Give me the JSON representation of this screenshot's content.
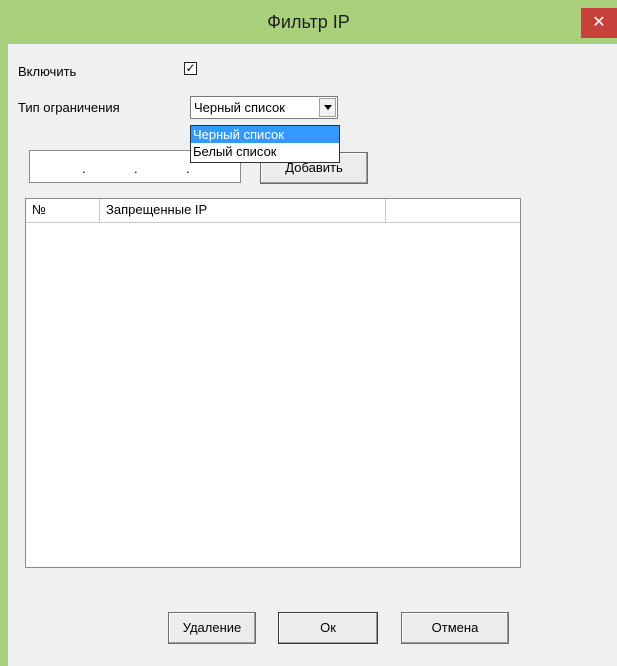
{
  "window": {
    "title": "Фильтр IP",
    "close_label": "✕",
    "accent_color": "#a9d17c",
    "close_color": "#c7403a"
  },
  "form": {
    "enable_label": "Включить",
    "enable_checked": true,
    "enable_mark": "✓",
    "restriction_label": "Тип ограничения",
    "restriction_value": "Черный список",
    "restriction_options": [
      "Черный список",
      "Белый список"
    ],
    "ip_dots": [
      ".",
      ".",
      "."
    ],
    "add_label": "Добавить"
  },
  "table": {
    "columns": [
      "№",
      "Запрещенные IP",
      ""
    ],
    "rows": []
  },
  "buttons": {
    "delete_label": "Удаление",
    "ok_label": "Ок",
    "cancel_label": "Отмена"
  },
  "watermark": {
    "icon": "brand-watermark"
  }
}
